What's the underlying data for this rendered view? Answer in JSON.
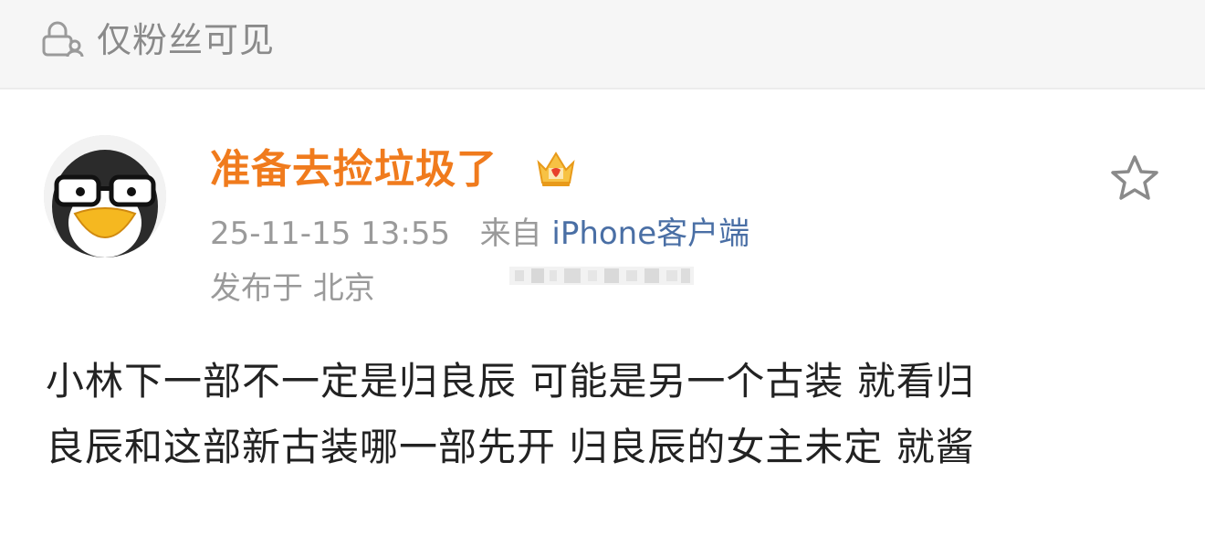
{
  "visibility": {
    "icon": "lock-person-icon",
    "text": "仅粉丝可见"
  },
  "post": {
    "author": {
      "name": "准备去捡垃圾了",
      "name_color": "#f07b1d",
      "avatar": "penguin-with-glasses-avatar",
      "badge": "vip-crown-badge-icon"
    },
    "time": "25-11-15 13:55",
    "from_label": "来自",
    "source": "iPhone客户端",
    "location": "发布于 北京",
    "favorite_icon": "star-outline-icon",
    "body_lines": [
      "小林下一部不一定是归良辰 可能是另一个古装 就看归",
      "良辰和这部新古装哪一部先开 归良辰的女主未定 就酱"
    ]
  }
}
